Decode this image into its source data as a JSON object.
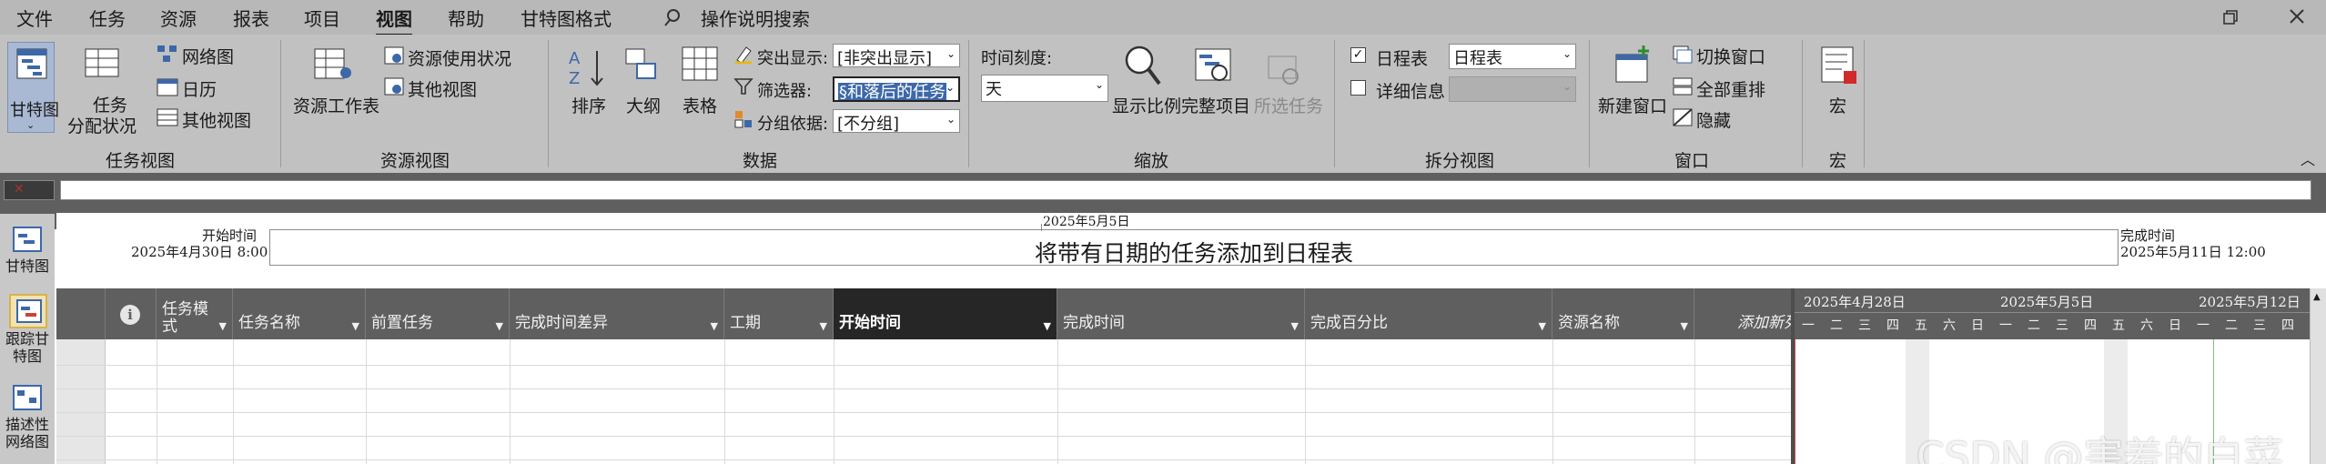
{
  "menu_tabs": [
    "文件",
    "任务",
    "资源",
    "报表",
    "项目",
    "视图",
    "帮助",
    "甘特图格式"
  ],
  "active_tab": "视图",
  "search": {
    "label": "操作说明搜索"
  },
  "ribbon": {
    "task_views": {
      "gantt_label": "甘特图",
      "assign_label1": "任务",
      "assign_label2": "分配状况",
      "network_label": "网络图",
      "calendar_label": "日历",
      "other_views_label": "其他视图",
      "group_label": "任务视图"
    },
    "resource_views": {
      "sheet_label": "资源工作表",
      "usage_label": "资源使用状况",
      "other_label": "其他视图",
      "group_label": "资源视图"
    },
    "data": {
      "sort_label": "排序",
      "outline_label": "大纲",
      "tables_label": "表格",
      "highlight_label": "突出显示:",
      "highlight_value": "[非突出显示]",
      "filter_label": "筛选器:",
      "filter_value": "§和落后的任务",
      "group_label": "分组依据:",
      "group_value": "[不分组]",
      "group_title": "数据"
    },
    "zoom": {
      "timescale_label": "时间刻度:",
      "timescale_value": "天",
      "zoom_label": "显示比例",
      "entire_label": "完整项目",
      "selected_label": "所选任务",
      "group_label": "缩放"
    },
    "split": {
      "timeline_label": "日程表",
      "timeline_checked": true,
      "timeline_value": "日程表",
      "details_label": "详细信息",
      "details_checked": false,
      "group_label": "拆分视图"
    },
    "window": {
      "new_label": "新建窗口",
      "switch_label": "切换窗口",
      "arrange_label": "全部重排",
      "hide_label": "隐藏",
      "group_label": "窗口"
    },
    "macros": {
      "macro_label": "宏",
      "group_label": "宏"
    }
  },
  "left_nav": [
    {
      "label1": "甘特图",
      "label2": ""
    },
    {
      "label1": "跟踪甘",
      "label2": "特图"
    },
    {
      "label1": "描述性",
      "label2": "网络图"
    }
  ],
  "timeline": {
    "today": "2025年5月5日",
    "start_title": "开始时间",
    "start_date": "2025年4月30日 8:00",
    "end_title": "完成时间",
    "end_date": "2025年5月11日 12:00",
    "placeholder": "将带有日期的任务添加到日程表"
  },
  "table": {
    "info_icon": "info-icon",
    "columns": [
      "任务模式",
      "任务名称",
      "前置任务",
      "完成时间差异",
      "工期",
      "开始时间",
      "完成时间",
      "完成百分比",
      "资源名称",
      "添加新列"
    ],
    "active_column": "开始时间"
  },
  "gantt": {
    "weeks": [
      "2025年4月28日",
      "2025年5月5日",
      "2025年5月12日"
    ],
    "weekday_letters": [
      "一",
      "二",
      "三",
      "四",
      "五",
      "六",
      "日",
      "一",
      "二",
      "三",
      "四",
      "五",
      "六",
      "日",
      "一",
      "二",
      "三",
      "四"
    ]
  },
  "watermark": "CSDN @害羞的白菜",
  "colors": {
    "ribbon": "#c1c1c1",
    "dark_header": "#5f5f5f",
    "active_header": "#262626",
    "selection": "#3d68a8"
  }
}
